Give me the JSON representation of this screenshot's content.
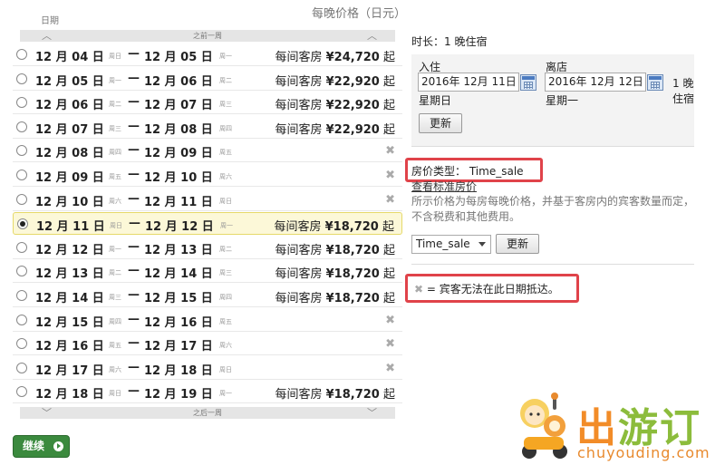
{
  "list": {
    "header_date": "日期",
    "header_price": "每晚价格（日元）",
    "prev_label": "之前一周",
    "next_label": "之后一周",
    "rows": [
      {
        "checkin": "12 月 04 日",
        "checkin_wd": "周日",
        "checkout": "12 月 05 日",
        "checkout_wd": "周一",
        "price_prefix": "每间客房",
        "price": "¥24,720",
        "price_suffix": "起",
        "available": true,
        "selected": false
      },
      {
        "checkin": "12 月 05 日",
        "checkin_wd": "周一",
        "checkout": "12 月 06 日",
        "checkout_wd": "周二",
        "price_prefix": "每间客房",
        "price": "¥22,920",
        "price_suffix": "起",
        "available": true,
        "selected": false
      },
      {
        "checkin": "12 月 06 日",
        "checkin_wd": "周二",
        "checkout": "12 月 07 日",
        "checkout_wd": "周三",
        "price_prefix": "每间客房",
        "price": "¥22,920",
        "price_suffix": "起",
        "available": true,
        "selected": false
      },
      {
        "checkin": "12 月 07 日",
        "checkin_wd": "周三",
        "checkout": "12 月 08 日",
        "checkout_wd": "周四",
        "price_prefix": "每间客房",
        "price": "¥22,920",
        "price_suffix": "起",
        "available": true,
        "selected": false
      },
      {
        "checkin": "12 月 08 日",
        "checkin_wd": "周四",
        "checkout": "12 月 09 日",
        "checkout_wd": "周五",
        "price_prefix": "",
        "price": "",
        "price_suffix": "",
        "available": false,
        "selected": false
      },
      {
        "checkin": "12 月 09 日",
        "checkin_wd": "周五",
        "checkout": "12 月 10 日",
        "checkout_wd": "周六",
        "price_prefix": "",
        "price": "",
        "price_suffix": "",
        "available": false,
        "selected": false
      },
      {
        "checkin": "12 月 10 日",
        "checkin_wd": "周六",
        "checkout": "12 月 11 日",
        "checkout_wd": "周日",
        "price_prefix": "",
        "price": "",
        "price_suffix": "",
        "available": false,
        "selected": false
      },
      {
        "checkin": "12 月 11 日",
        "checkin_wd": "周日",
        "checkout": "12 月 12 日",
        "checkout_wd": "周一",
        "price_prefix": "每间客房",
        "price": "¥18,720",
        "price_suffix": "起",
        "available": true,
        "selected": true
      },
      {
        "checkin": "12 月 12 日",
        "checkin_wd": "周一",
        "checkout": "12 月 13 日",
        "checkout_wd": "周二",
        "price_prefix": "每间客房",
        "price": "¥18,720",
        "price_suffix": "起",
        "available": true,
        "selected": false
      },
      {
        "checkin": "12 月 13 日",
        "checkin_wd": "周二",
        "checkout": "12 月 14 日",
        "checkout_wd": "周三",
        "price_prefix": "每间客房",
        "price": "¥18,720",
        "price_suffix": "起",
        "available": true,
        "selected": false
      },
      {
        "checkin": "12 月 14 日",
        "checkin_wd": "周三",
        "checkout": "12 月 15 日",
        "checkout_wd": "周四",
        "price_prefix": "每间客房",
        "price": "¥18,720",
        "price_suffix": "起",
        "available": true,
        "selected": false
      },
      {
        "checkin": "12 月 15 日",
        "checkin_wd": "周四",
        "checkout": "12 月 16 日",
        "checkout_wd": "周五",
        "price_prefix": "",
        "price": "",
        "price_suffix": "",
        "available": false,
        "selected": false
      },
      {
        "checkin": "12 月 16 日",
        "checkin_wd": "周五",
        "checkout": "12 月 17 日",
        "checkout_wd": "周六",
        "price_prefix": "",
        "price": "",
        "price_suffix": "",
        "available": false,
        "selected": false
      },
      {
        "checkin": "12 月 17 日",
        "checkin_wd": "周六",
        "checkout": "12 月 18 日",
        "checkout_wd": "周日",
        "price_prefix": "",
        "price": "",
        "price_suffix": "",
        "available": false,
        "selected": false
      },
      {
        "checkin": "12 月 18 日",
        "checkin_wd": "周日",
        "checkout": "12 月 19 日",
        "checkout_wd": "周一",
        "price_prefix": "每间客房",
        "price": "¥18,720",
        "price_suffix": "起",
        "available": true,
        "selected": false
      }
    ],
    "unavailable_icon": "x-icon",
    "continue_label": "继续"
  },
  "stay": {
    "duration": "时长：1 晚住宿",
    "checkin_label": "入住",
    "checkin_value": "2016年 12月 11日",
    "checkin_weekday": "星期日",
    "checkout_label": "离店",
    "checkout_value": "2016年 12月 12日",
    "checkout_weekday": "星期一",
    "nights": "1 晚住宿",
    "update_label": "更新"
  },
  "rate": {
    "type_label": "房价类型：",
    "type_value": "Time_sale",
    "standard_link": "查看标准房价",
    "note": "所示价格为每房每晚价格，并基于客房内的宾客数量而定，不含税费和其他费用。",
    "select_value": "Time_sale",
    "update_label": "更新"
  },
  "legend": {
    "text": "= 宾客无法在此日期抵达。"
  },
  "brand": {
    "name_part1": "出",
    "name_part2": "游",
    "name_part3": "订",
    "site": "chuyouding.com"
  },
  "colors": {
    "highlight": "#e0434a",
    "continue_button": "#3b8a3e",
    "selected_row": "#fcf8d8",
    "brand_orange": "#f28c28",
    "brand_green": "#8cbc3c"
  }
}
